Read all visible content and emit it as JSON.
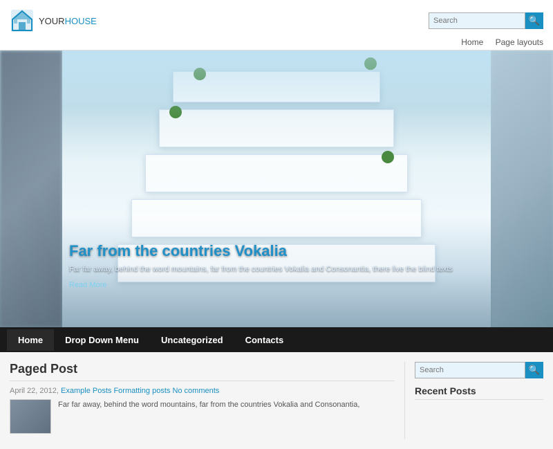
{
  "site": {
    "logo_your": "YOUR",
    "logo_house": "HOUSE"
  },
  "header": {
    "search_placeholder": "Search",
    "search_icon": "🔍"
  },
  "top_nav": {
    "items": [
      {
        "label": "Home",
        "href": "#"
      },
      {
        "label": "Page layouts",
        "href": "#"
      }
    ]
  },
  "hero": {
    "title": "Far from the countries Vokalia",
    "description": "Far far away, behind the word mountains, far from the countries Vokalia and Consonantia, there live the blind texts",
    "read_more": "Read More"
  },
  "main_nav": {
    "items": [
      {
        "label": "Home",
        "active": true
      },
      {
        "label": "Drop Down Menu",
        "active": false
      },
      {
        "label": "Uncategorized",
        "active": false
      },
      {
        "label": "Contacts",
        "active": false
      }
    ]
  },
  "paged_post": {
    "title": "Paged Post",
    "date": "April 22, 2012",
    "links": [
      {
        "label": "Example Posts"
      },
      {
        "label": "Formatting posts"
      },
      {
        "label": "No comments"
      }
    ],
    "body": "Far far away, behind the word mountains, far from the countries Vokalia and Consonantia,"
  },
  "sidebar": {
    "search_placeholder": "Search",
    "search_icon": "🔍",
    "recent_posts_title": "Recent Posts"
  }
}
